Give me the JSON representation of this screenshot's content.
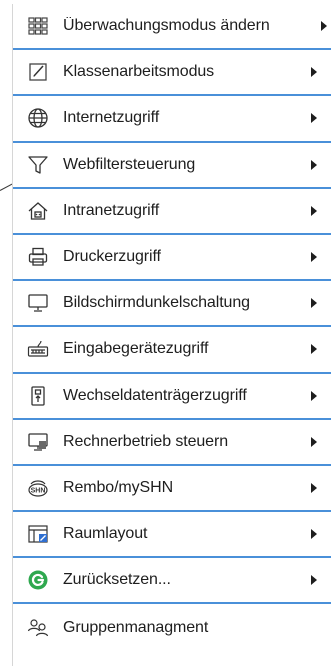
{
  "menu": {
    "items": [
      {
        "label": "Überwachungsmodus ändern",
        "icon": "grid-view-icon",
        "has_submenu": true
      },
      {
        "label": "Klassenarbeitsmodus",
        "icon": "edit-document-icon",
        "has_submenu": true
      },
      {
        "label": "Internetzugriff",
        "icon": "globe-icon",
        "has_submenu": true
      },
      {
        "label": "Webfiltersteuerung",
        "icon": "filter-funnel-icon",
        "has_submenu": true
      },
      {
        "label": "Intranetzugriff",
        "icon": "home-network-icon",
        "has_submenu": true
      },
      {
        "label": "Druckerzugriff",
        "icon": "printer-icon",
        "has_submenu": true
      },
      {
        "label": "Bildschirmdunkelschaltung",
        "icon": "monitor-icon",
        "has_submenu": true
      },
      {
        "label": "Eingabegerätezugriff",
        "icon": "keyboard-icon",
        "has_submenu": true
      },
      {
        "label": "Wechseldatenträgerzugriff",
        "icon": "usb-drive-icon",
        "has_submenu": true
      },
      {
        "label": "Rechnerbetrieb steuern",
        "icon": "computer-control-icon",
        "has_submenu": true
      },
      {
        "label": "Rembo/mySHN",
        "icon": "shn-icon",
        "has_submenu": true
      },
      {
        "label": "Raumlayout",
        "icon": "room-layout-icon",
        "has_submenu": true
      },
      {
        "label": "Zurücksetzen...",
        "icon": "reset-icon",
        "has_submenu": true
      },
      {
        "label": "Gruppenmanagment",
        "icon": "group-users-icon",
        "has_submenu": false
      }
    ]
  },
  "colors": {
    "separator": "#4a90d9",
    "text": "#1e1e1e",
    "reset_green": "#2fa84f",
    "raumlayout_blue": "#2f6fd1"
  }
}
